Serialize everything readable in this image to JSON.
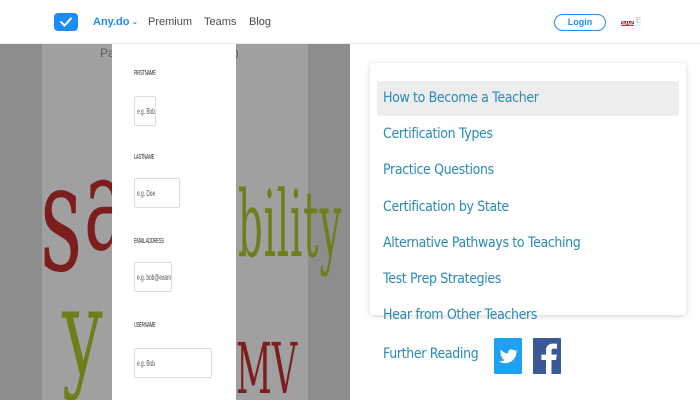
{
  "nav": {
    "brand": "Any.do",
    "links": [
      "Premium",
      "Teams",
      "Blog"
    ],
    "login": "Login",
    "lang_code": "E",
    "accent": "#1d8cf8"
  },
  "background": {
    "header_text_left": "Pa",
    "header_text_right": "l)",
    "art": {
      "letter_s": "s",
      "letter_a": "a",
      "letter_y": "y",
      "word_bility": "bility",
      "word_mv": "MV"
    },
    "form": [
      {
        "label": "FIRSTNAME",
        "value": "e.g. Bob"
      },
      {
        "label": "LASTNAME",
        "value": "e.g. Doe"
      },
      {
        "label": "EMAIL ADDRESS",
        "value": "e.g. bob@example.com"
      },
      {
        "label": "USERNAME",
        "value": "e.g. Bob"
      }
    ]
  },
  "menu": {
    "items": [
      "How to Become a Teacher",
      "Certification Types",
      "Practice Questions",
      "Certification by State",
      "Alternative Pathways to Teaching",
      "Test Prep Strategies",
      "Hear from Other Teachers"
    ],
    "link_color": "#2a8ab8",
    "highlight_color": "#ededed"
  },
  "footer": {
    "further_reading": "Further Reading",
    "icons": [
      "twitter-icon",
      "facebook-icon"
    ],
    "twitter_color": "#1da1f2",
    "facebook_color": "#3b5998"
  }
}
